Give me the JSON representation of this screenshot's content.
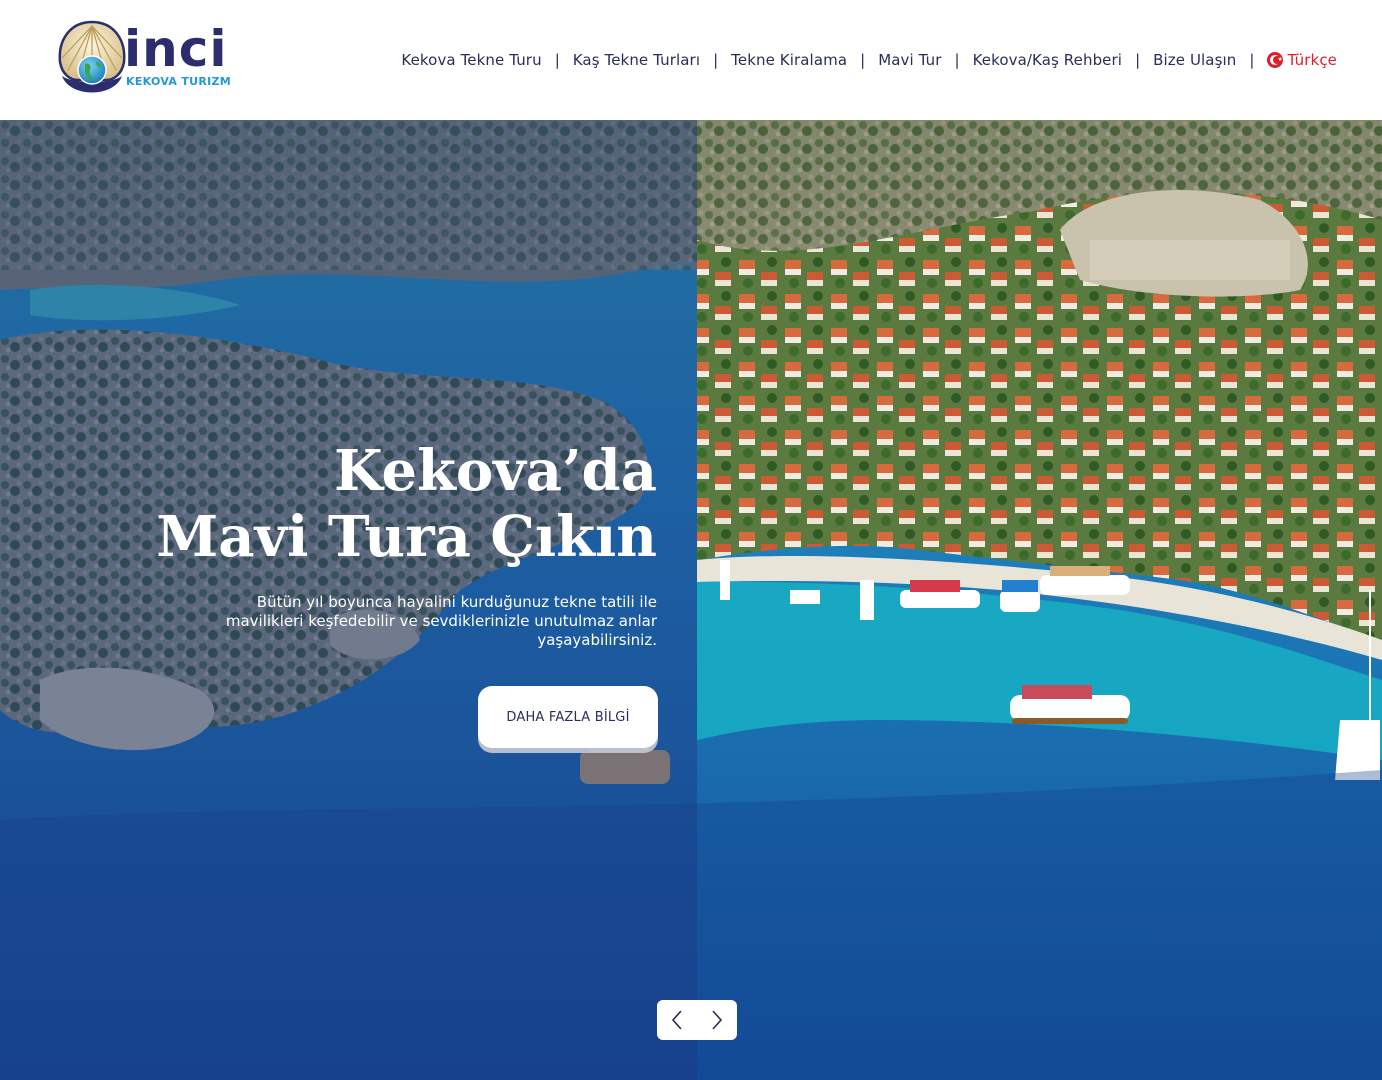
{
  "brand": {
    "name": "inci",
    "tagline": "KEKOVA TURIZM"
  },
  "nav": {
    "items": [
      {
        "label": "Kekova Tekne Turu"
      },
      {
        "label": "Kaş Tekne Turları"
      },
      {
        "label": "Tekne Kiralama"
      },
      {
        "label": "Mavi Tur"
      },
      {
        "label": "Kekova/Kaş Rehberi"
      },
      {
        "label": "Bize Ulaşın"
      }
    ],
    "separator": "|",
    "language": {
      "label": "Türkçe",
      "icon": "turkey-flag-icon"
    }
  },
  "hero": {
    "title_line1": "Kekova’da",
    "title_line2": "Mavi Tura Çıkın",
    "description": "Bütün yıl boyunca hayalini kurduğunuz tekne tatili ile mavilikleri keşfedebilir ve sevdiklerinizle unutulmaz anlar yaşayabilirsiniz.",
    "button_label": "DAHA FAZLA BİLGİ"
  },
  "slider": {
    "prev_icon": "chevron-left-icon",
    "next_icon": "chevron-right-icon"
  },
  "colors": {
    "brand_navy": "#2b2d5c",
    "brand_blue": "#1f9ad6",
    "accent_red": "#e01e2b",
    "sea_blue": "#1c6fb8"
  }
}
